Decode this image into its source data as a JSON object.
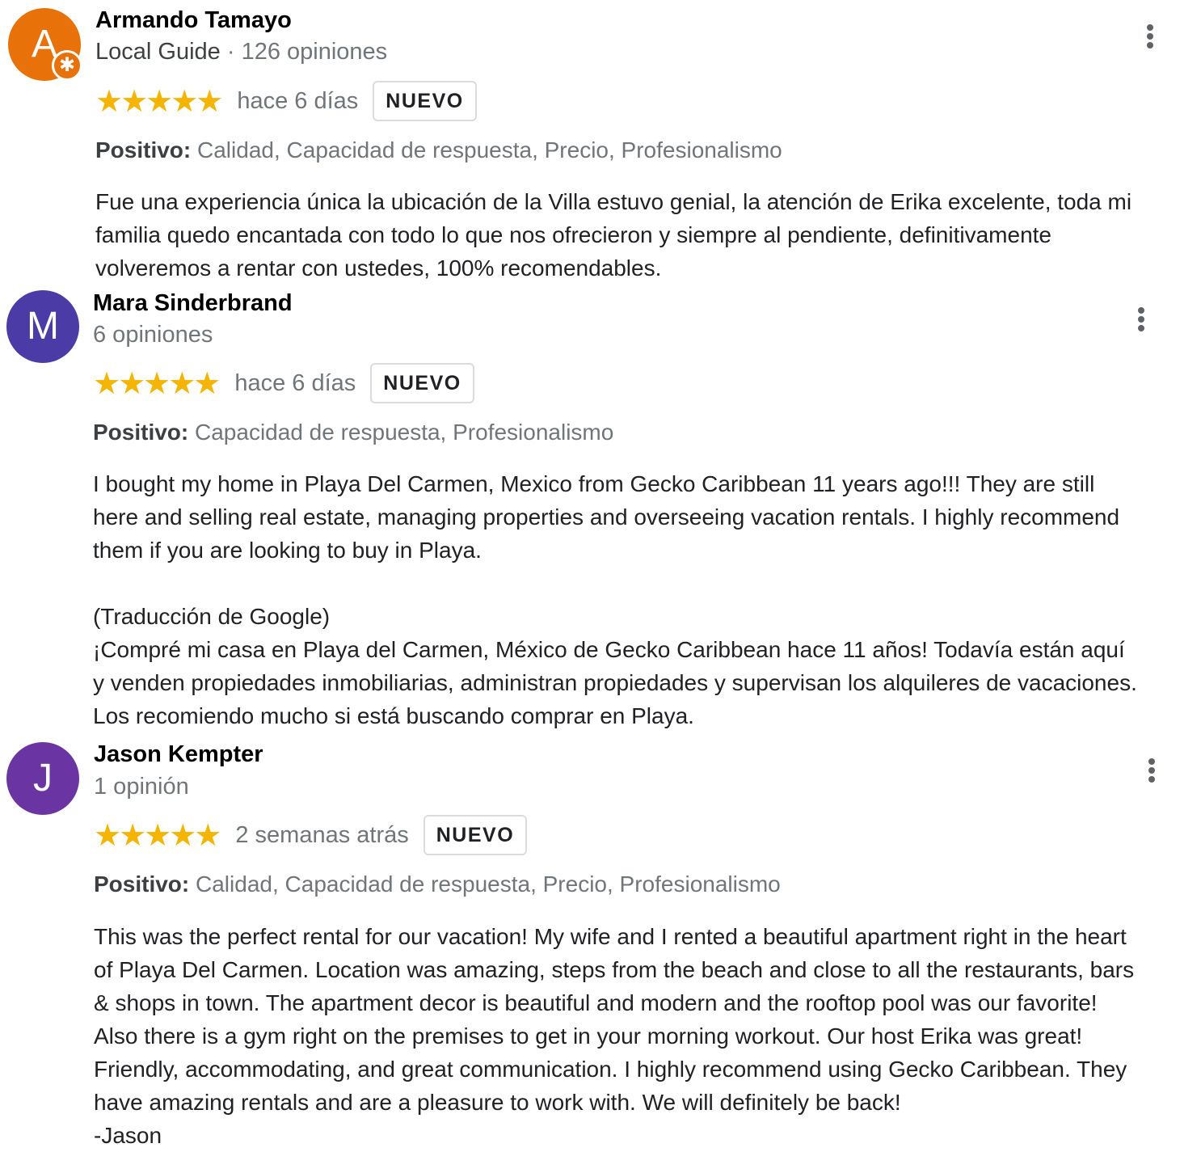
{
  "reviews": [
    {
      "avatar_letter": "A",
      "avatar_color": "#e8710a",
      "local_guide_badge": "star-icon",
      "name": "Armando Tamayo",
      "guide_label": "Local Guide",
      "separator": " · ",
      "review_count": "126 opiniones",
      "stars": "★★★★★",
      "rating": 5,
      "date": "hace 6 días",
      "badge": "NUEVO",
      "positive_label": "Positivo:",
      "positive_items": "Calidad, Capacidad de respuesta, Precio, Profesionalismo",
      "text_lines": [
        "Fue una experiencia única la ubicación de la Villa estuvo genial, la atención de Erika excelente, toda mi",
        "familia quedo encantada con todo lo que nos ofrecieron y siempre al pendiente, definitivamente",
        "volveremos a rentar con ustedes, 100% recomendables."
      ]
    },
    {
      "avatar_letter": "M",
      "avatar_color": "#4a3ba6",
      "name": "Mara Sinderbrand",
      "review_count": "6 opiniones",
      "stars": "★★★★★",
      "rating": 5,
      "date": "hace 6 días",
      "badge": "NUEVO",
      "positive_label": "Positivo:",
      "positive_items": "Capacidad de respuesta, Profesionalismo",
      "text_lines": [
        "I bought my home in Playa Del Carmen, Mexico from Gecko Caribbean 11 years ago!!! They are still",
        "here and selling real estate, managing properties and overseeing vacation rentals. I highly recommend",
        "them if you are looking to buy in Playa.",
        "",
        "(Traducción de Google)",
        "¡Compré mi casa en Playa del Carmen, México de Gecko Caribbean hace 11 años! Todavía están aquí",
        "y venden propiedades inmobiliarias, administran propiedades y supervisan los alquileres de vacaciones.",
        "Los recomiendo mucho si está buscando comprar en Playa."
      ]
    },
    {
      "avatar_letter": "J",
      "avatar_color": "#6a35a2",
      "name": "Jason Kempter",
      "review_count": "1 opinión",
      "stars": "★★★★★",
      "rating": 5,
      "date": "2 semanas atrás",
      "badge": "NUEVO",
      "positive_label": "Positivo:",
      "positive_items": "Calidad, Capacidad de respuesta, Precio, Profesionalismo",
      "text_lines": [
        "This was the perfect rental for our vacation! My wife and I rented a beautiful apartment right in the heart",
        "of Playa Del Carmen. Location was amazing, steps from the beach and close to all the restaurants, bars",
        "& shops in town. The apartment decor is beautiful and modern and the rooftop pool was our favorite!",
        "Also there is a gym right on the premises to get in your morning workout. Our host Erika was great!",
        "Friendly, accommodating, and great communication. I highly recommend using Gecko Caribbean. They",
        "have amazing rentals and are a pleasure to work with. We will definitely be back!",
        "-Jason"
      ]
    }
  ]
}
